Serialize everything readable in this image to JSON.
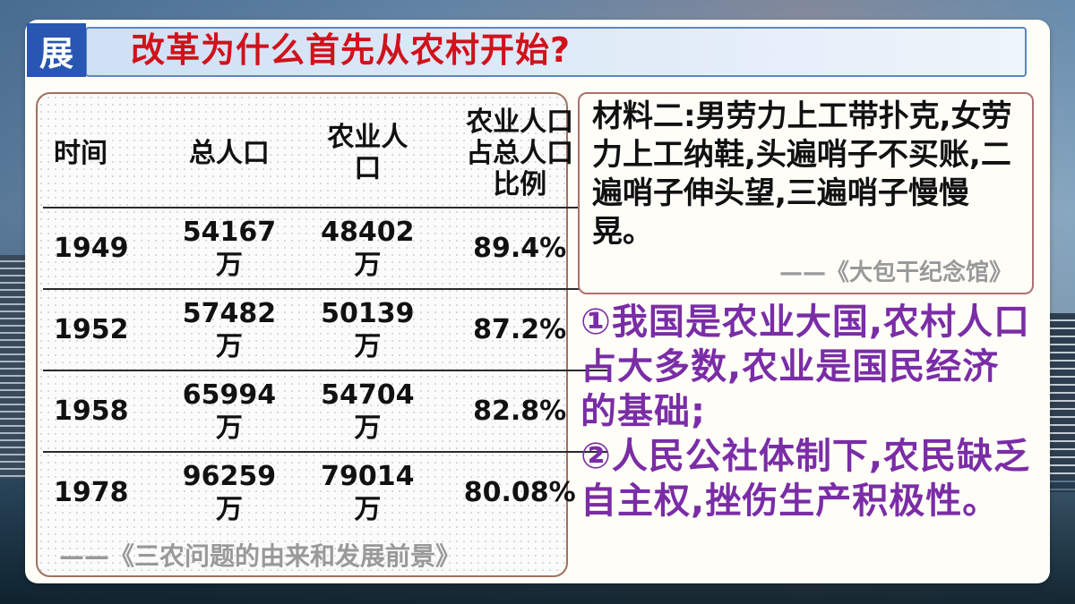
{
  "header": {
    "badge": "展",
    "title": "改革为什么首先从农村开始?"
  },
  "table": {
    "headers": [
      "时间",
      "总人口",
      "农业人口",
      "农业人口占总人口比例"
    ],
    "rows": [
      {
        "year": "1949",
        "total": "54167万",
        "agri": "48402万",
        "ratio": "89.4%"
      },
      {
        "year": "1952",
        "total": "57482万",
        "agri": "50139万",
        "ratio": "87.2%"
      },
      {
        "year": "1958",
        "total": "65994万",
        "agri": "54704万",
        "ratio": "82.8%"
      },
      {
        "year": "1978",
        "total": "96259万",
        "agri": "79014万",
        "ratio": "80.08%"
      }
    ],
    "source": "——《三农问题的由来和发展前景》"
  },
  "material": {
    "text": "材料二:男劳力上工带扑克,女劳力上工纳鞋,头遍哨子不买账,二遍哨子伸头望,三遍哨子慢慢晃。",
    "source": "——《大包干纪念馆》"
  },
  "answer": {
    "point1": "①我国是农业大国,农村人口占大多数,农业是国民经济的基础;",
    "point2": "②人民公社体制下,农民缺乏自主权,挫伤生产积极性。"
  },
  "colors": {
    "title": "#d0121b",
    "badge_bg": "#2956b2",
    "answer": "#7a2da6"
  }
}
